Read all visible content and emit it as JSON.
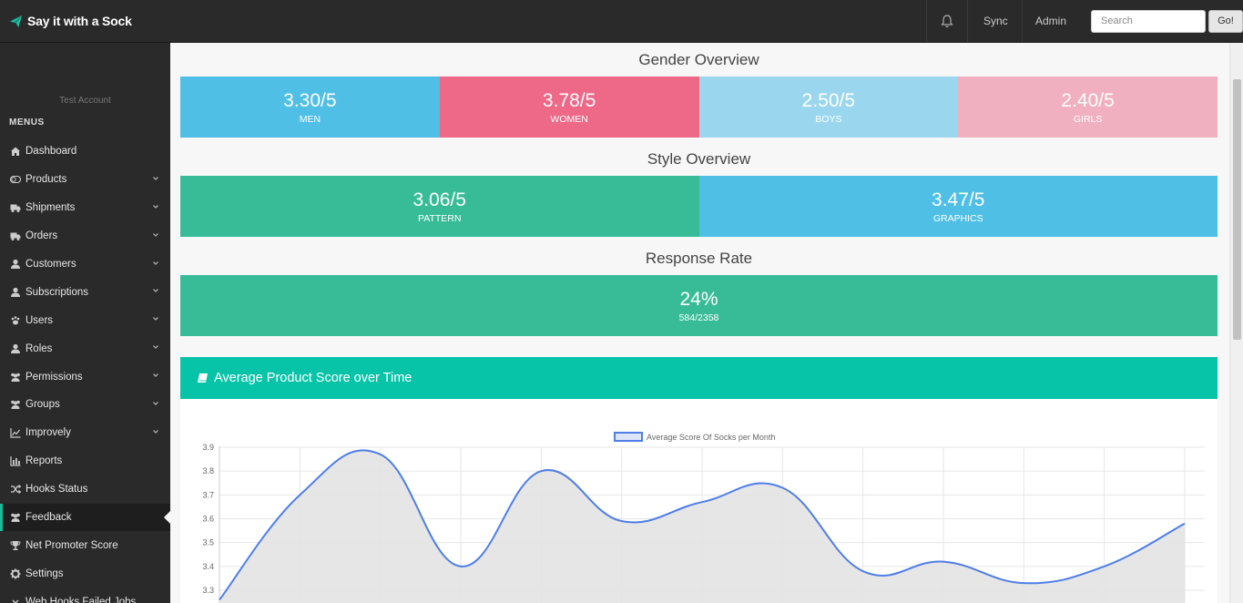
{
  "app": {
    "brand": "Say it with a Sock"
  },
  "topnav": {
    "sync_label": "Sync",
    "admin_label": "Admin",
    "search_placeholder": "Search",
    "go_label": "Go!"
  },
  "sidebar": {
    "account": "Test Account",
    "menus_label": "MENUS",
    "items": [
      {
        "label": "Dashboard",
        "icon": "home-icon",
        "expandable": false
      },
      {
        "label": "Products",
        "icon": "toggle-icon",
        "expandable": true
      },
      {
        "label": "Shipments",
        "icon": "truck-icon",
        "expandable": true
      },
      {
        "label": "Orders",
        "icon": "truck-icon",
        "expandable": true
      },
      {
        "label": "Customers",
        "icon": "user-icon",
        "expandable": true
      },
      {
        "label": "Subscriptions",
        "icon": "user-icon",
        "expandable": true
      },
      {
        "label": "Users",
        "icon": "paw-icon",
        "expandable": true
      },
      {
        "label": "Roles",
        "icon": "user-icon",
        "expandable": true
      },
      {
        "label": "Permissions",
        "icon": "group-icon",
        "expandable": true
      },
      {
        "label": "Groups",
        "icon": "group-icon",
        "expandable": true
      },
      {
        "label": "Improvely",
        "icon": "line-chart-icon",
        "expandable": true
      },
      {
        "label": "Reports",
        "icon": "bar-chart-icon",
        "expandable": false
      },
      {
        "label": "Hooks Status",
        "icon": "random-icon",
        "expandable": false
      },
      {
        "label": "Feedback",
        "icon": "group-icon",
        "expandable": false,
        "active": true
      },
      {
        "label": "Net Promoter Score",
        "icon": "trophy-icon",
        "expandable": false
      },
      {
        "label": "Settings",
        "icon": "gear-icon",
        "expandable": false
      },
      {
        "label": "Web Hooks Failed Jobs",
        "icon": "chevron-icon",
        "expandable": false
      }
    ]
  },
  "gender": {
    "title": "Gender Overview",
    "stats": [
      {
        "value": "3.30/5",
        "label": "MEN",
        "color": "#4fbfe6"
      },
      {
        "value": "3.78/5",
        "label": "WOMEN",
        "color": "#ee6888"
      },
      {
        "value": "2.50/5",
        "label": "BOYS",
        "color": "#9ad7ee"
      },
      {
        "value": "2.40/5",
        "label": "GIRLS",
        "color": "#f0b0bf"
      }
    ]
  },
  "style": {
    "title": "Style Overview",
    "stats": [
      {
        "value": "3.06/5",
        "label": "PATTERN",
        "color": "#38bc98"
      },
      {
        "value": "3.47/5",
        "label": "GRAPHICS",
        "color": "#4fbfe6"
      }
    ]
  },
  "response": {
    "title": "Response Rate",
    "value": "24%",
    "label": "584/2358",
    "color": "#38bc98"
  },
  "panel": {
    "title": "Average Product Score over Time",
    "accent": "#07c4a9"
  },
  "chart_data": {
    "type": "area",
    "series": [
      {
        "name": "Average Score Of Socks per Month",
        "values": [
          3.26,
          3.7,
          3.87,
          3.4,
          3.8,
          3.59,
          3.67,
          3.73,
          3.38,
          3.42,
          3.33,
          3.4,
          3.58
        ]
      }
    ],
    "y_ticks": [
      "3.9",
      "3.8",
      "3.7",
      "3.6",
      "3.5",
      "3.4",
      "3.3"
    ],
    "ylim": [
      3.3,
      3.9
    ],
    "grid": true,
    "legend": "top-center",
    "line_color": "#4e7ee8",
    "fill_color": "#e3e3e3"
  }
}
